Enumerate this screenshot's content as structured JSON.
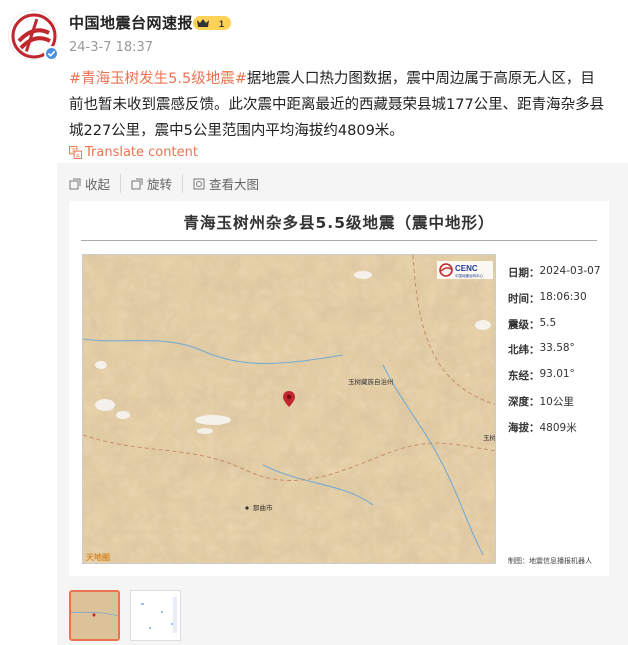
{
  "author": {
    "name": "中国地震台网速报",
    "vip_level": "1",
    "time": "24-3-7 18:37"
  },
  "post": {
    "hashtag": "#青海玉树发生5.5级地震#",
    "text": "据地震人口热力图数据，震中周边属于高原无人区，目前也暂未收到震感反馈。此次震中距离最近的西藏聂荣县城177公里、距青海杂多县城227公里，震中5公里范围内平均海拔约4809米。",
    "translate_label": "Translate content"
  },
  "toolbar": {
    "collect_label": "收起",
    "rotate_label": "旋转",
    "view_large_label": "查看大图"
  },
  "map": {
    "title": "青海玉树州杂多县5.5级地震（震中地形）",
    "logo_text": "CENC",
    "logo_sub": "中国地震台网中心",
    "places": {
      "yushu": "玉树藏族自治州",
      "nagqu": "那曲市",
      "yushu_short": "玉树"
    },
    "corner_logo": "天地图",
    "info": [
      {
        "label": "日期：",
        "value": "2024-03-07"
      },
      {
        "label": "时间：",
        "value": "18:06:30"
      },
      {
        "label": "震级：",
        "value": "5.5"
      },
      {
        "label": "北纬：",
        "value": "33.58°"
      },
      {
        "label": "东经：",
        "value": "93.01°"
      },
      {
        "label": "深度：",
        "value": "10公里"
      },
      {
        "label": "海拔：",
        "value": "4809米"
      }
    ],
    "credit": "制图：地震信息播报机器人"
  },
  "colors": {
    "accent": "#eb7350",
    "terrain": "#e8d2a8",
    "marker": "#c0282e",
    "verify": "#4a90e2"
  }
}
